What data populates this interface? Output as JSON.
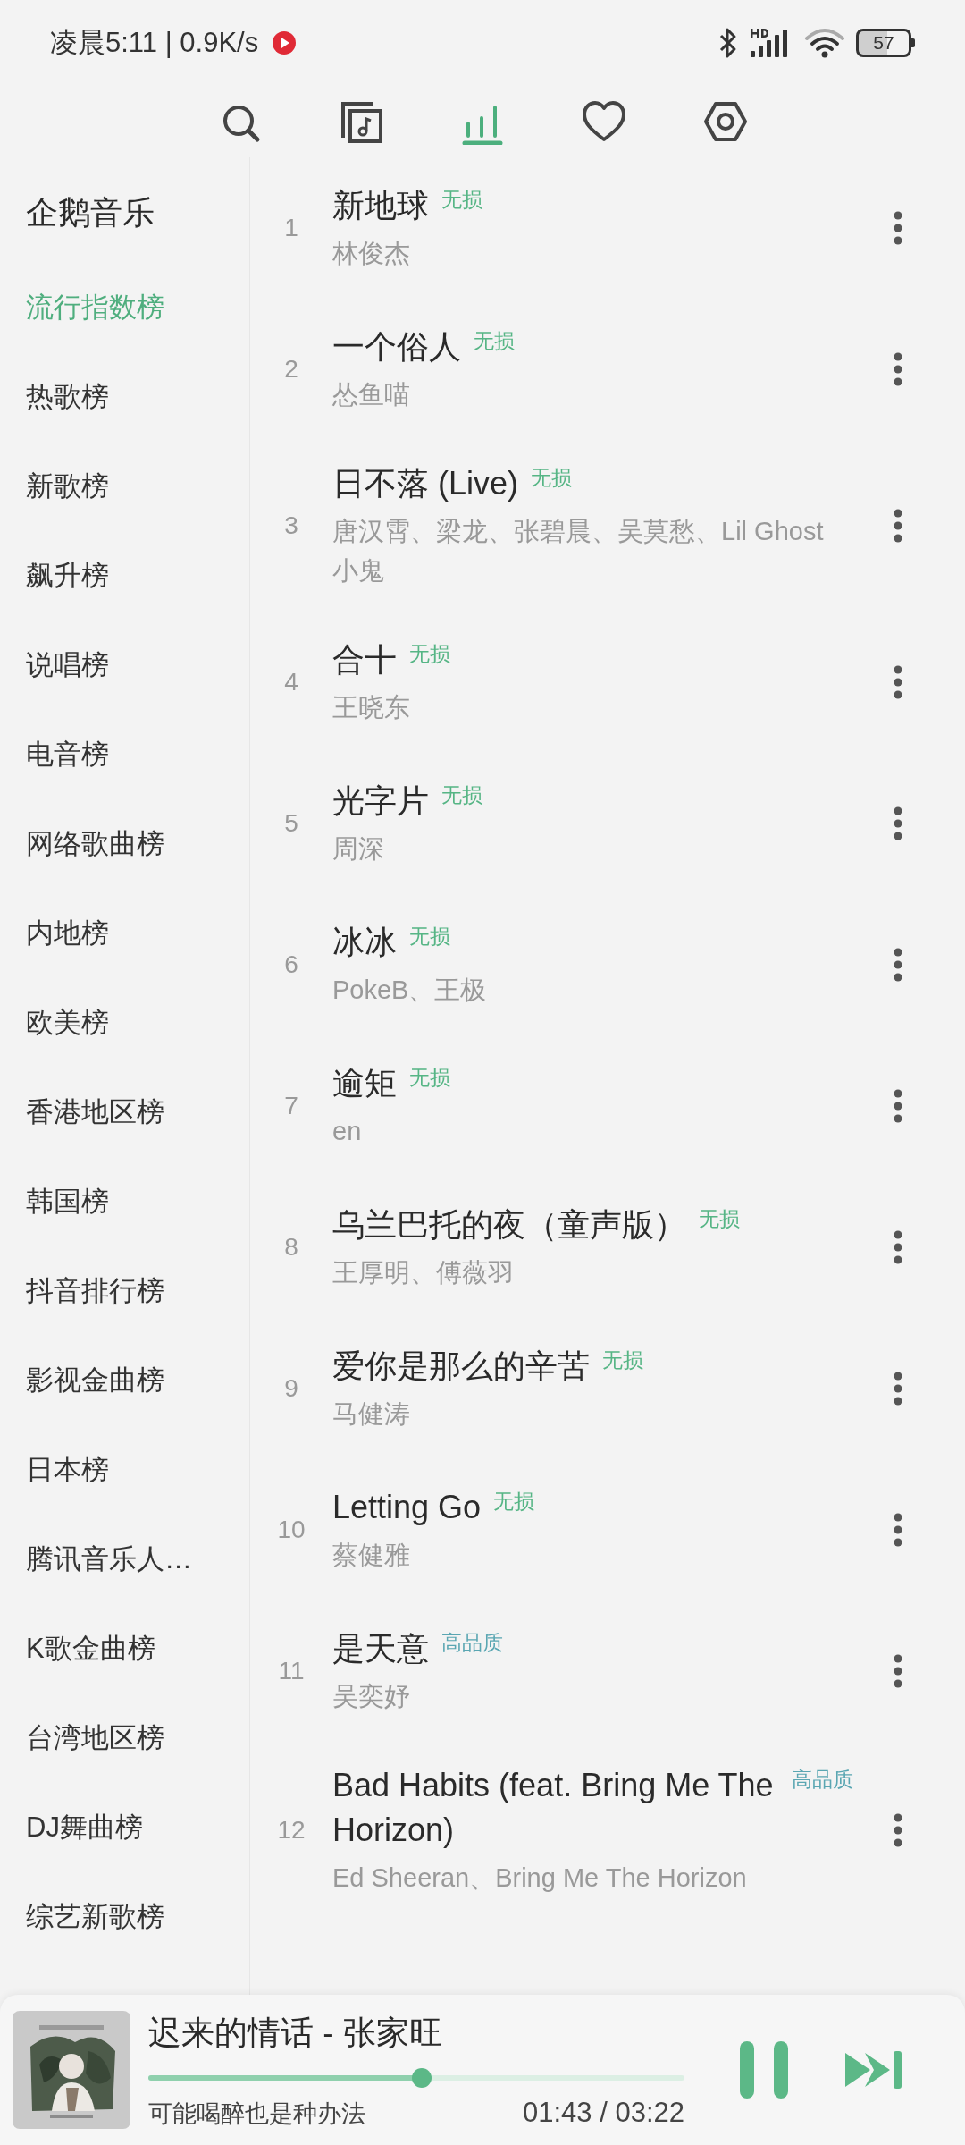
{
  "status_bar": {
    "text": "凌晨5:11 | 0.9K/s",
    "battery": "57"
  },
  "nav_tabs": [
    {
      "kind": "search",
      "selected": false
    },
    {
      "kind": "library",
      "selected": false
    },
    {
      "kind": "charts",
      "selected": true
    },
    {
      "kind": "favorites",
      "selected": false
    },
    {
      "kind": "settings",
      "selected": false
    }
  ],
  "sidebar": {
    "heading": "企鹅音乐",
    "items": [
      {
        "label": "流行指数榜",
        "selected": true
      },
      {
        "label": "热歌榜",
        "selected": false
      },
      {
        "label": "新歌榜",
        "selected": false
      },
      {
        "label": "飙升榜",
        "selected": false
      },
      {
        "label": "说唱榜",
        "selected": false
      },
      {
        "label": "电音榜",
        "selected": false
      },
      {
        "label": "网络歌曲榜",
        "selected": false
      },
      {
        "label": "内地榜",
        "selected": false
      },
      {
        "label": "欧美榜",
        "selected": false
      },
      {
        "label": "香港地区榜",
        "selected": false
      },
      {
        "label": "韩国榜",
        "selected": false
      },
      {
        "label": "抖音排行榜",
        "selected": false
      },
      {
        "label": "影视金曲榜",
        "selected": false
      },
      {
        "label": "日本榜",
        "selected": false
      },
      {
        "label": "腾讯音乐人…",
        "selected": false
      },
      {
        "label": "K歌金曲榜",
        "selected": false
      },
      {
        "label": "台湾地区榜",
        "selected": false
      },
      {
        "label": "DJ舞曲榜",
        "selected": false
      },
      {
        "label": "综艺新歌榜",
        "selected": false
      }
    ]
  },
  "songs": [
    {
      "rank": "1",
      "title": "新地球",
      "tag": {
        "text": "无损",
        "kind": "lossless"
      },
      "artist": "林俊杰"
    },
    {
      "rank": "2",
      "title": "一个俗人",
      "tag": {
        "text": "无损",
        "kind": "lossless"
      },
      "artist": "怂鱼喵"
    },
    {
      "rank": "3",
      "title": "日不落 (Live)",
      "tag": {
        "text": "无损",
        "kind": "lossless"
      },
      "artist": "唐汉霄、梁龙、张碧晨、吴莫愁、Lil Ghost小鬼"
    },
    {
      "rank": "4",
      "title": "合十",
      "tag": {
        "text": "无损",
        "kind": "lossless"
      },
      "artist": "王晓东"
    },
    {
      "rank": "5",
      "title": "光字片",
      "tag": {
        "text": "无损",
        "kind": "lossless"
      },
      "artist": "周深"
    },
    {
      "rank": "6",
      "title": "冰冰",
      "tag": {
        "text": "无损",
        "kind": "lossless"
      },
      "artist": "PokeB、王极"
    },
    {
      "rank": "7",
      "title": "逾矩",
      "tag": {
        "text": "无损",
        "kind": "lossless"
      },
      "artist": "en"
    },
    {
      "rank": "8",
      "title": "乌兰巴托的夜（童声版）",
      "tag": {
        "text": "无损",
        "kind": "lossless"
      },
      "artist": "王厚明、傅薇羽"
    },
    {
      "rank": "9",
      "title": "爱你是那么的辛苦",
      "tag": {
        "text": "无损",
        "kind": "lossless"
      },
      "artist": "马健涛"
    },
    {
      "rank": "10",
      "title": "Letting Go",
      "tag": {
        "text": "无损",
        "kind": "lossless"
      },
      "artist": "蔡健雅"
    },
    {
      "rank": "11",
      "title": "是天意",
      "tag": {
        "text": "高品质",
        "kind": "hq"
      },
      "artist": "吴奕妤"
    },
    {
      "rank": "12",
      "title": "Bad Habits (feat. Bring Me The Horizon)",
      "tag": {
        "text": "高品质",
        "kind": "hq"
      },
      "artist": "Ed Sheeran、Bring Me The Horizon"
    }
  ],
  "player": {
    "title": "迟来的情话 - 张家旺",
    "lyric": "可能喝醉也是种办法",
    "time": "01:43 / 03:22",
    "level": 0.51,
    "playing": true
  }
}
